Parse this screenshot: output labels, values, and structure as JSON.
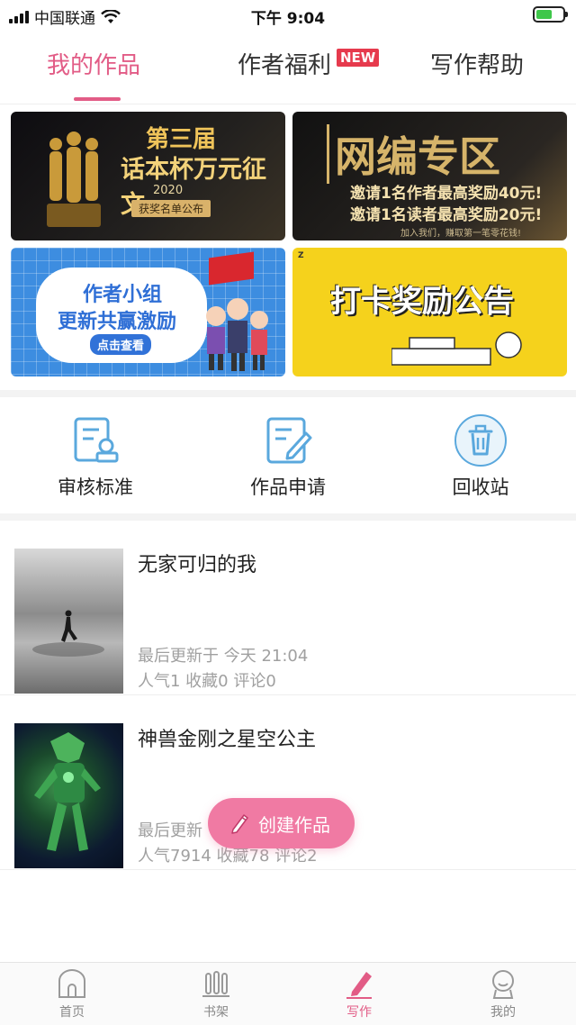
{
  "status_bar": {
    "carrier": "中国联通",
    "time": "下午 9:04"
  },
  "top_tabs": [
    {
      "label": "我的作品",
      "active": true
    },
    {
      "label": "作者福利",
      "active": false,
      "badge": "NEW"
    },
    {
      "label": "写作帮助",
      "active": false
    }
  ],
  "banners": {
    "b1": {
      "line1": "第三届",
      "line2": "话本杯万元征文",
      "year": "2020",
      "pill": "获奖名单公布"
    },
    "b2": {
      "title": "网编专区",
      "sub1": "邀请1名作者最高奖励40元!",
      "sub2": "邀请1名读者最高奖励20元!",
      "sub3": "加入我们，赚取第一笔零花钱!"
    },
    "b3": {
      "line1": "作者小组",
      "line2": "更新共赢激励",
      "button": "点击查看"
    },
    "b4": {
      "title": "打卡奖励公告"
    }
  },
  "actions": [
    {
      "label": "审核标准",
      "icon": "review-standard-icon"
    },
    {
      "label": "作品申请",
      "icon": "work-apply-icon"
    },
    {
      "label": "回收站",
      "icon": "trash-icon"
    }
  ],
  "works": [
    {
      "title": "无家可归的我",
      "updated": "最后更新于 今天 21:04",
      "stats": "人气1 收藏0 评论0"
    },
    {
      "title": "神兽金刚之星空公主",
      "updated": "最后更新",
      "stats": "人气7914 收藏78 评论2"
    }
  ],
  "create_button": {
    "label": "创建作品"
  },
  "bottom_nav": [
    {
      "label": "首页",
      "active": false
    },
    {
      "label": "书架",
      "active": false
    },
    {
      "label": "写作",
      "active": true
    },
    {
      "label": "我的",
      "active": false
    }
  ],
  "colors": {
    "accent": "#e25c86",
    "create_button": "#f07aa3",
    "badge_new": "#e63a4d",
    "action_icon": "#5aa8dd"
  }
}
